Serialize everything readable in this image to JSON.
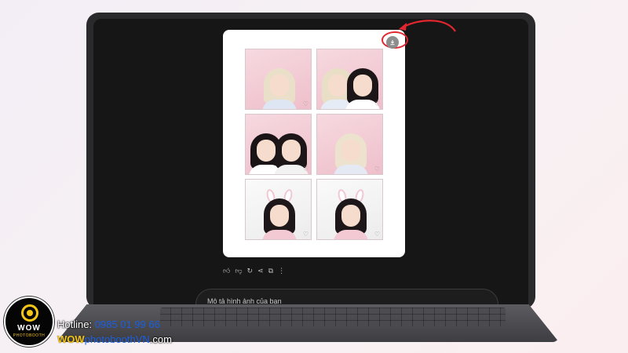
{
  "prompt": {
    "placeholder": "Mô tả hình ảnh của bạn"
  },
  "logo": {
    "name": "WOW",
    "subtitle": "PHOTOBOOTH"
  },
  "contact": {
    "hotline_label": "Hotline: ",
    "hotline_number": "0985 01 99 66",
    "website_brand": "WOW",
    "website_mid": "photoboothVN",
    "website_tld": ".com"
  },
  "icons": {
    "download": "download-icon",
    "like": "thumbs-up-icon",
    "dislike": "thumbs-down-icon",
    "regenerate": "refresh-icon",
    "share": "share-icon",
    "copy": "copy-icon",
    "more": "more-vertical-icon",
    "favorite": "heart-icon"
  },
  "colors": {
    "highlight": "#e2262f",
    "accent_blue": "#1a5fe0",
    "accent_yellow": "#f5c518"
  }
}
